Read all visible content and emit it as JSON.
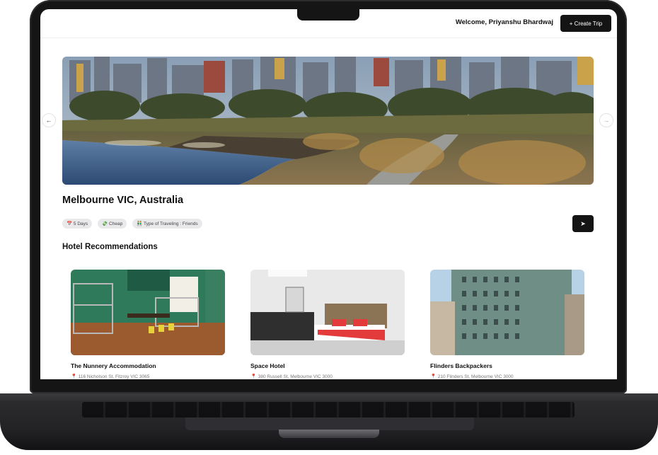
{
  "header": {
    "welcome_text": "Welcome, Priyanshu Bhardwaj",
    "create_trip_label": "+ Create Trip"
  },
  "carousel": {
    "prev_icon": "←",
    "next_icon": "→"
  },
  "trip": {
    "destination": "Melbourne VIC, Australia",
    "chips": [
      {
        "icon": "calendar-icon",
        "label": "📅 5 Days"
      },
      {
        "icon": "money-icon",
        "label": "💸 Cheap"
      },
      {
        "icon": "people-icon",
        "label": "👬 Type of Traveling : Friends"
      }
    ],
    "share_icon": "➤"
  },
  "hotels": {
    "title": "Hotel Recommendations",
    "items": [
      {
        "name": "The Nunnery Accommodation",
        "address": "116 Nicholson St, Fitzroy VIC 3065"
      },
      {
        "name": "Space Hotel",
        "address": "380 Russell St, Melbourne VIC 3000"
      },
      {
        "name": "Flinders Backpackers",
        "address": "210 Flinders St, Melbourne VIC 3000"
      }
    ]
  },
  "colors": {
    "primary_button": "#141414",
    "chip_bg": "#e9e9eb",
    "pin": "#e0393e"
  }
}
